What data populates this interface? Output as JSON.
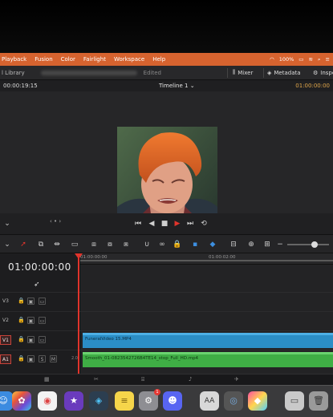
{
  "menubar": {
    "items": [
      "Playback",
      "Fusion",
      "Color",
      "Fairlight",
      "Workspace",
      "Help"
    ],
    "battery": "100%"
  },
  "appbar": {
    "library_label": "l Library",
    "project_status": "Edited",
    "mixer_label": "Mixer",
    "metadata_label": "Metadata",
    "inspector_label": "Inspector"
  },
  "viewer": {
    "source_timecode": "00:00:19:15",
    "timeline_name": "Timeline 1",
    "record_timecode": "01:00:00:00"
  },
  "timeline": {
    "current_timecode": "01:00:00:00",
    "ruler_labels": [
      "01:00:00:00",
      "01:00:02:00"
    ],
    "tracks": [
      {
        "name": "V3",
        "active": false
      },
      {
        "name": "V2",
        "active": false
      },
      {
        "name": "V1",
        "active": true
      },
      {
        "name": "A1",
        "active": true,
        "volume": "2.0"
      }
    ],
    "video_clip": "FuneralVideo 15.MP4",
    "audio_clip": "Smooth_01-0823542726B4TE14_stop_Full_HD.mp4"
  },
  "pages": {
    "tabs": [
      "media",
      "cut",
      "edit",
      "fusion",
      "color",
      "fairlight",
      "deliver"
    ]
  },
  "dock": {
    "apps": [
      "finder-icon",
      "photos-icon",
      "chrome-icon",
      "imovie-icon",
      "davinci-icon",
      "notes-icon",
      "settings-icon",
      "discord-icon",
      "fonts-icon",
      "quicktime-icon",
      "craft-icon",
      "preview-icon",
      "trash-icon"
    ],
    "settings_badge": "1"
  },
  "colors": {
    "menubar": "#d6632f",
    "playhead": "#e0342c",
    "video_clip": "#2b8ec6",
    "audio_clip": "#3fae45",
    "timecode_accent": "#e0a64a"
  }
}
